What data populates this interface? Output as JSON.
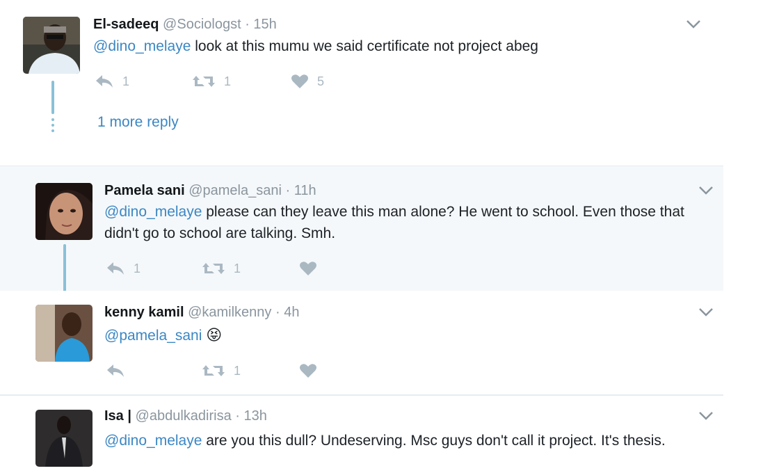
{
  "tweets": [
    {
      "name": "El-sadeeq",
      "handle": "@Sociologst",
      "separator": "·",
      "time": "15h",
      "mention": "@dino_melaye",
      "text": " look at this mumu we said certificate not project abeg",
      "reply_count": "1",
      "retweet_count": "1",
      "like_count": "5",
      "more_replies": "1 more reply"
    },
    {
      "name": "Pamela sani",
      "handle": "@pamela_sani",
      "separator": "·",
      "time": "11h",
      "mention": "@dino_melaye",
      "text": " please can they leave this man alone? He went to school. Even those that didn't go to school are talking. Smh.",
      "reply_count": "1",
      "retweet_count": "1",
      "like_count": ""
    },
    {
      "name": "kenny kamil",
      "handle": "@kamilkenny",
      "separator": "·",
      "time": "4h",
      "mention": "@pamela_sani",
      "text": " ",
      "emoji": "😝",
      "reply_count": "",
      "retweet_count": "1",
      "like_count": ""
    },
    {
      "name": "Isa |",
      "handle": "@abdulkadirisa",
      "separator": "·",
      "time": "13h",
      "mention": "@dino_melaye",
      "text": " are you this dull? Undeserving. Msc guys don't call it project. It's thesis."
    }
  ],
  "colors": {
    "link": "#3b87c4",
    "meta": "#8a959e",
    "icon": "#aab8c2",
    "thread_line": "#8ac0d8",
    "highlight_bg": "#f5f8fa"
  },
  "icons": {
    "reply": "reply-icon",
    "retweet": "retweet-icon",
    "like": "heart-icon",
    "caret": "chevron-down-icon"
  }
}
